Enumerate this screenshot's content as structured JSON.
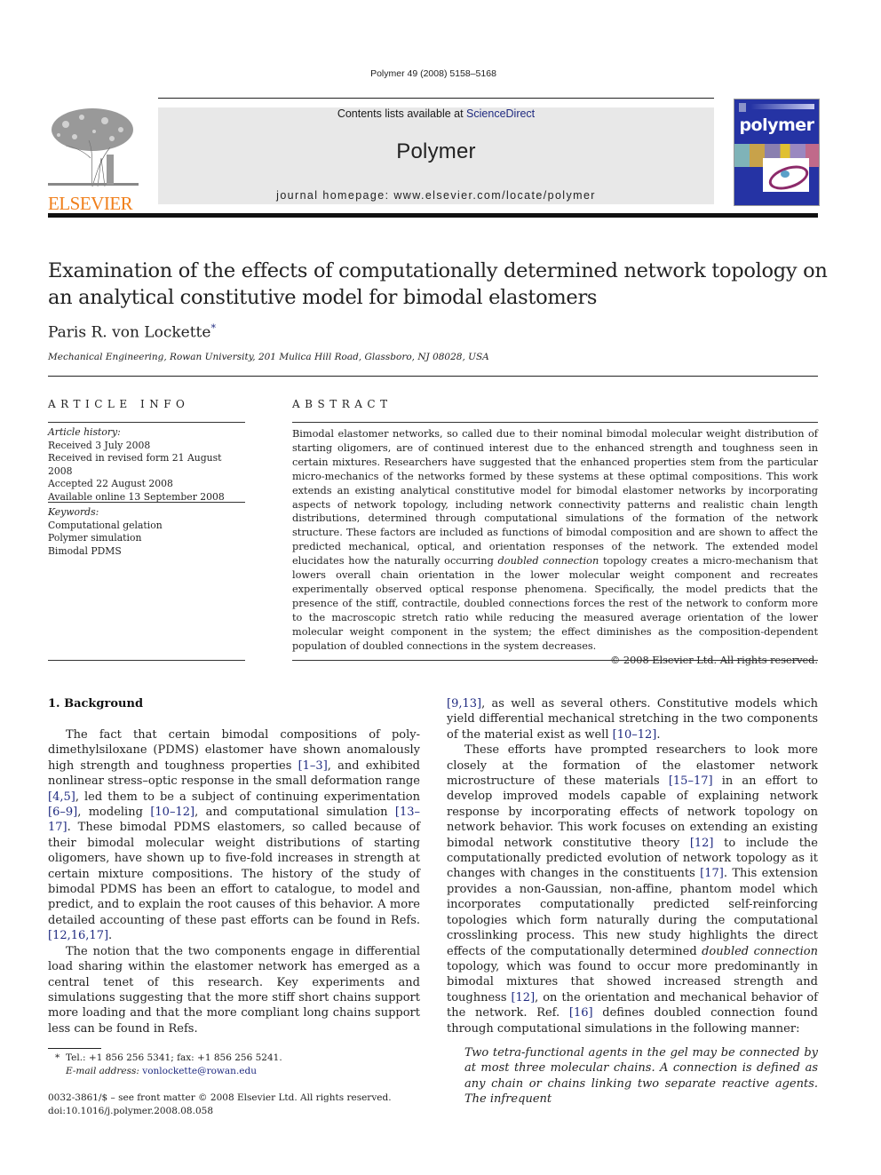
{
  "header": {
    "journal_ref": "Polymer 49 (2008) 5158–5168",
    "contents_prefix": "Contents lists available at ",
    "contents_link": "ScienceDirect",
    "journal_name": "Polymer",
    "homepage": "journal homepage: www.elsevier.com/locate/polymer",
    "publisher_logo_text": "ELSEVIER",
    "cover_title": "polymer",
    "colors": {
      "elsevier_orange": "#f07f1b",
      "link_blue": "#1f2a80",
      "cover_blue": "#2533a4",
      "masthead_gray": "#e8e8e8"
    }
  },
  "article": {
    "title": "Examination of the effects of computationally determined network topology on an analytical constitutive model for bimodal elastomers",
    "author": "Paris R. von Lockette",
    "author_mark": "*",
    "affiliation": "Mechanical Engineering, Rowan University, 201 Mulica Hill Road, Glassboro, NJ 08028, USA"
  },
  "article_info": {
    "heading": "ARTICLE INFO",
    "history_label": "Article history:",
    "history": [
      "Received 3 July 2008",
      "Received in revised form 21 August 2008",
      "Accepted 22 August 2008",
      "Available online 13 September 2008"
    ],
    "keywords_label": "Keywords:",
    "keywords": [
      "Computational gelation",
      "Polymer simulation",
      "Bimodal PDMS"
    ]
  },
  "abstract": {
    "heading": "ABSTRACT",
    "part1": "Bimodal elastomer networks, so called due to their nominal bimodal molecular weight distribution of starting oligomers, are of continued interest due to the enhanced strength and toughness seen in certain mixtures. Researchers have suggested that the enhanced properties stem from the particular micro-mechanics of the networks formed by these systems at these optimal compositions. This work extends an existing analytical constitutive model for bimodal elastomer networks by incorporating aspects of network topology, including network connectivity patterns and realistic chain length distributions, determined through computational simulations of the formation of the network structure. These factors are included as functions of bimodal composition and are shown to affect the predicted mechanical, optical, and orientation responses of the network. The extended model elucidates how the naturally occurring ",
    "italic": "doubled connection",
    "part2": " topology creates a micro-mechanism that lowers overall chain orientation in the lower molecular weight component and recreates experimentally observed optical response phenomena. Specifically, the model predicts that the presence of the stiff, contractile, doubled connections forces the rest of the network to conform more to the macroscopic stretch ratio while reducing the measured average orientation of the lower molecular weight component in the system; the effect diminishes as the composition-dependent population of doubled connections in the system decreases.",
    "copyright": "© 2008 Elsevier Ltd. All rights reserved."
  },
  "body": {
    "section_heading": "1.  Background",
    "p1": [
      {
        "t": "The fact that certain bimodal compositions of poly-dimethylsiloxane (PDMS) elastomer have shown anomalously high strength and toughness properties "
      },
      {
        "c": "[1–3]"
      },
      {
        "t": ", and exhibited nonlinear stress–optic response in the small deformation range "
      },
      {
        "c": "[4,5]"
      },
      {
        "t": ", led them to be a subject of continuing experimentation "
      },
      {
        "c": "[6–9]"
      },
      {
        "t": ", modeling "
      },
      {
        "c": "[10–12]"
      },
      {
        "t": ", and computational simulation "
      },
      {
        "c": "[13–17]"
      },
      {
        "t": ". These bimodal PDMS elastomers, so called because of their bimodal molecular weight distributions of starting oligomers, have shown up to five-fold increases in strength at certain mixture compositions. The history of the study of bimodal PDMS has been an effort to catalogue, to model and predict, and to explain the root causes of this behavior. A more detailed accounting of these past efforts can be found in Refs. "
      },
      {
        "c": "[12,16,17]"
      },
      {
        "t": "."
      }
    ],
    "p2": [
      {
        "t": "The notion that the two components engage in differential load sharing within the elastomer network has emerged as a central tenet of this research. Key experiments and simulations suggesting that the more stiff short chains support more loading and that the more compliant long chains support less can be found in Refs. "
      }
    ],
    "p2_cont": [
      {
        "c": "[9,13]"
      },
      {
        "t": ", as well as several others. Constitutive models which yield differential mechanical stretching in the two components of the material exist as well "
      },
      {
        "c": "[10–12]"
      },
      {
        "t": "."
      }
    ],
    "p3": [
      {
        "t": "These efforts have prompted researchers to look more closely at the formation of the elastomer network microstructure of these materials "
      },
      {
        "c": "[15–17]"
      },
      {
        "t": " in an effort to develop improved models capable of explaining network response by incorporating effects of network topology on network behavior. This work focuses on extending an existing bimodal network constitutive theory "
      },
      {
        "c": "[12]"
      },
      {
        "t": " to include the computationally predicted evolution of network topology as it changes with changes in the constituents "
      },
      {
        "c": "[17]"
      },
      {
        "t": ". This extension provides a non-Gaussian, non-affine, phantom model which incorporates computationally predicted self-reinforcing topologies which form naturally during the computational crosslinking process. This new study highlights the direct effects of the computationally determined "
      },
      {
        "i": "doubled connection"
      },
      {
        "t": " topology, which was found to occur more predominantly in bimodal mixtures that showed increased strength and toughness "
      },
      {
        "c": "[12]"
      },
      {
        "t": ", on the orientation and mechanical behavior of the network. Ref. "
      },
      {
        "c": "[16]"
      },
      {
        "t": " defines doubled connection found through computational simulations in the following manner:"
      }
    ],
    "quote": "Two tetra-functional agents in the gel may be connected by at most three molecular chains. A connection is defined as any chain or chains linking two separate reactive agents. The infrequent"
  },
  "footnote": {
    "mark": "*",
    "contact": "Tel.: +1 856 256 5341; fax: +1 856 256 5241.",
    "email_label": "E-mail address: ",
    "email": "vonlockette@rowan.edu"
  },
  "front_matter": {
    "issn_line": "0032-3861/$ – see front matter © 2008 Elsevier Ltd. All rights reserved.",
    "doi": "doi:10.1016/j.polymer.2008.08.058"
  }
}
